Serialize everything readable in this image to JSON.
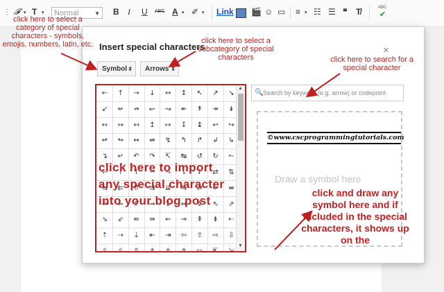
{
  "toolbar": {
    "font_icon": "𝓕",
    "size_icon": "T",
    "format_value": "Normal",
    "bold": "B",
    "italic": "I",
    "underline": "U",
    "strike": "ABC",
    "text_color": "A",
    "link": "Link",
    "spell": "ABC"
  },
  "dialog": {
    "title": "Insert special characters",
    "close": "×",
    "category": "Symbol",
    "subcategory": "Arrows",
    "search_placeholder": "Search by keyword (e.g. arrow) or codepoint",
    "draw_placeholder": "Draw a symbol here",
    "drawn_text": "©www.cscprogrammingtutorials.com",
    "symbols": [
      "←",
      "↑",
      "→",
      "↓",
      "↔",
      "↕",
      "↖",
      "↗",
      "↘",
      "↙",
      "↚",
      "↛",
      "↜",
      "↝",
      "↞",
      "↟",
      "↠",
      "↡",
      "↢",
      "↣",
      "↤",
      "↥",
      "↦",
      "↧",
      "↨",
      "↩",
      "↪",
      "↫",
      "↬",
      "↭",
      "↮",
      "↯",
      "↰",
      "↱",
      "↲",
      "↳",
      "↴",
      "↵",
      "↶",
      "↷",
      "↸",
      "↹",
      "↺",
      "↻",
      "↼",
      "↽",
      "↾",
      "↿",
      "⇀",
      "⇁",
      "⇂",
      "⇃",
      "⇄",
      "⇅",
      "⇆",
      "⇇",
      "⇈",
      "⇉",
      "⇊",
      "⇋",
      "⇌",
      "⇍",
      "⇎",
      "⇏",
      "⇐",
      "⇑",
      "⇒",
      "⇓",
      "⇔",
      "⇕",
      "⇖",
      "⇗",
      "⇘",
      "⇙",
      "⇚",
      "⇛",
      "⇜",
      "⇝",
      "⇞",
      "⇟",
      "⇠",
      "⇡",
      "⇢",
      "⇣",
      "⇤",
      "⇥",
      "⇦",
      "⇧",
      "⇨",
      "⇩",
      "⇪",
      "⇫",
      "⇬",
      "⇭",
      "⇮",
      "⇯",
      "⇰",
      "⇱",
      "⇲"
    ]
  },
  "annotations": {
    "category": "click here to select a category of special characters - symbols, emojis, numbers, latin, etc.",
    "subcategory": "click here to select a subcategory of special characters",
    "search": "click here to search for a special character",
    "grid": "click here to import any special character into your blog post",
    "draw": "click and draw any symbol here and if included in the special characters, it shows up on the"
  },
  "colors": {
    "annotation": "#c0201f",
    "link": "#1155cc"
  }
}
